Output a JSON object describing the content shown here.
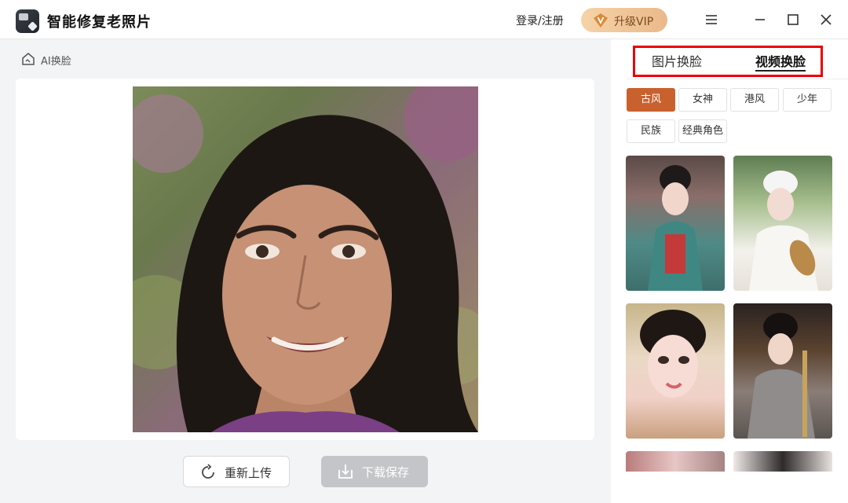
{
  "app": {
    "title": "智能修复老照片"
  },
  "header": {
    "login_label": "登录/注册",
    "vip_label": "升级VIP",
    "vip_icon": "vip-diamond-icon"
  },
  "breadcrumb": {
    "label": "AI换脸",
    "icon": "home-icon"
  },
  "actions": {
    "reupload_label": "重新上传",
    "download_label": "下载保存"
  },
  "panel": {
    "tabs": [
      {
        "label": "图片换脸",
        "active": false
      },
      {
        "label": "视频换脸",
        "active": true
      }
    ],
    "categories": [
      {
        "label": "古风",
        "active": true
      },
      {
        "label": "女神",
        "active": false
      },
      {
        "label": "港风",
        "active": false
      },
      {
        "label": "少年",
        "active": false
      },
      {
        "label": "民族",
        "active": false
      },
      {
        "label": "经典角色",
        "active": false
      }
    ],
    "accent_color": "#c9612e",
    "highlight_color": "#e8000a"
  }
}
